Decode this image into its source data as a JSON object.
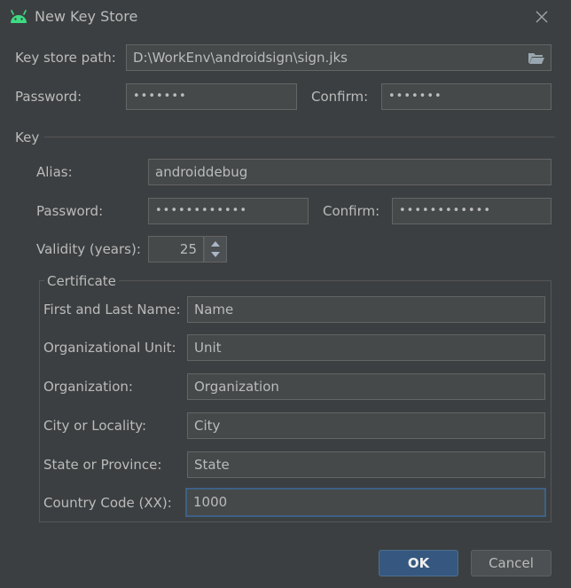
{
  "window": {
    "title": "New Key Store",
    "close_icon": "close-icon",
    "app_icon": "android-icon"
  },
  "keystore": {
    "path_label": "Key store path:",
    "path_value": "D:\\WorkEnv\\androidsign\\sign.jks",
    "password_label": "Password:",
    "password_value": "•••••••",
    "confirm_label": "Confirm:",
    "confirm_value": "•••••••"
  },
  "key": {
    "section_label": "Key",
    "alias_label": "Alias:",
    "alias_value": "androiddebug",
    "password_label": "Password:",
    "password_value": "••••••••••••",
    "confirm_label": "Confirm:",
    "confirm_value": "••••••••••••",
    "validity_label": "Validity (years):",
    "validity_value": "25"
  },
  "certificate": {
    "section_label": "Certificate",
    "fields": [
      {
        "label": "First and Last Name:",
        "value": "Name"
      },
      {
        "label": "Organizational Unit:",
        "value": "Unit"
      },
      {
        "label": "Organization:",
        "value": "Organization"
      },
      {
        "label": "City or Locality:",
        "value": "City"
      },
      {
        "label": "State or Province:",
        "value": "State"
      },
      {
        "label": "Country Code (XX):",
        "value": "1000"
      }
    ]
  },
  "buttons": {
    "ok": "OK",
    "cancel": "Cancel"
  },
  "colors": {
    "background": "#3c3f41",
    "field": "#45494a",
    "primary": "#365880",
    "android_green": "#3ddc84"
  }
}
